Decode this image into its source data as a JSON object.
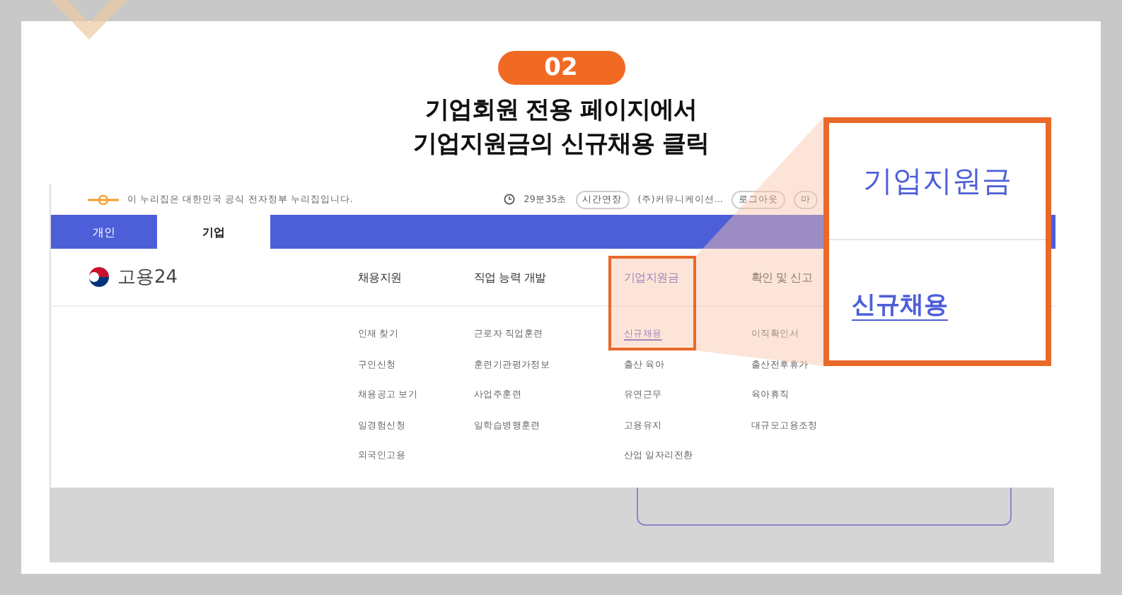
{
  "step": "02",
  "heading": [
    "기업회원 전용 페이지에서",
    "기업지원금의 신규채용 클릭"
  ],
  "site": {
    "notice": "이 누리집은 대한민국 공식 전자정부 누리집입니다.",
    "timer": "29분35초",
    "extend_button": "시간연장",
    "user": "(주)커뮤니케이션...",
    "logout_button": "로그아웃",
    "mypage_button": "마"
  },
  "user_tabs": [
    {
      "label": "개인",
      "selected": false
    },
    {
      "label": "기업",
      "selected": true
    }
  ],
  "logo": "고용24",
  "menus": [
    {
      "label": "채용지원",
      "selected": false,
      "items": [
        {
          "label": "인재 찾기",
          "selected": false
        },
        {
          "label": "구인신청",
          "selected": false
        },
        {
          "label": "채용공고 보기",
          "selected": false
        },
        {
          "label": "일경험신청",
          "selected": false
        },
        {
          "label": "외국인고용",
          "selected": false
        }
      ]
    },
    {
      "label": "직업 능력 개발",
      "selected": false,
      "items": [
        {
          "label": "근로자 직업훈련",
          "selected": false
        },
        {
          "label": "훈련기관평가정보",
          "selected": false
        },
        {
          "label": "사업주훈련",
          "selected": false
        },
        {
          "label": "일학습병행훈련",
          "selected": false
        }
      ]
    },
    {
      "label": "기업지원금",
      "selected": true,
      "items": [
        {
          "label": "신규채용",
          "selected": true
        },
        {
          "label": "출산 육아",
          "selected": false
        },
        {
          "label": "유연근무",
          "selected": false
        },
        {
          "label": "고용유지",
          "selected": false
        },
        {
          "label": "산업 일자리전환",
          "selected": false
        }
      ]
    },
    {
      "label": "확인 및 신고",
      "selected": false,
      "items": [
        {
          "label": "이직확인서",
          "selected": false
        },
        {
          "label": "출산전후휴가",
          "selected": false
        },
        {
          "label": "육아휴직",
          "selected": false
        },
        {
          "label": "대규모고용조정",
          "selected": false
        }
      ]
    }
  ],
  "callout": {
    "menu": "기업지원금",
    "item": "신규채용"
  }
}
